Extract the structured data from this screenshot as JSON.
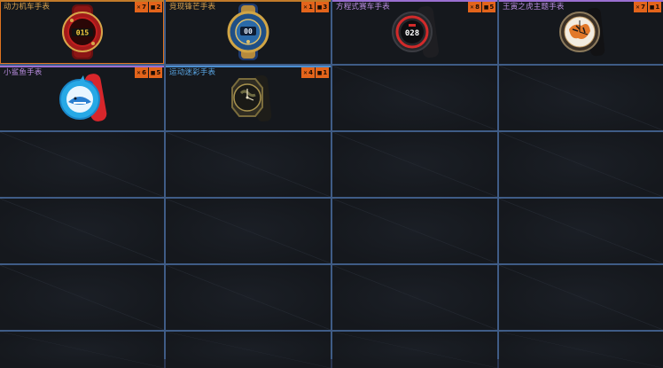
{
  "items": [
    {
      "name": "动力机车手表",
      "name_color": "#d9a24e",
      "line_color": "#c27a2a",
      "badge_a": "7",
      "badge_b": "2",
      "icon": "watch-red-digital-icon"
    },
    {
      "name": "竞现锋芒手表",
      "name_color": "#d9a24e",
      "line_color": "#c27a2a",
      "badge_a": "1",
      "badge_b": "3",
      "icon": "watch-blue-gold-icon"
    },
    {
      "name": "方程式赛车手表",
      "name_color": "#b98de0",
      "line_color": "#9a6fd0",
      "badge_a": "8",
      "badge_b": "5",
      "icon": "watch-racing-black-icon"
    },
    {
      "name": "王寅之虎主题手表",
      "name_color": "#b98de0",
      "line_color": "#9a6fd0",
      "badge_a": "7",
      "badge_b": "1",
      "icon": "watch-tiger-theme-icon"
    },
    {
      "name": "小鲨鱼手表",
      "name_color": "#b98de0",
      "line_color": "#9a6fd0",
      "badge_a": "6",
      "badge_b": "5",
      "icon": "watch-shark-kids-icon"
    },
    {
      "name": "运动迷彩手表",
      "name_color": "#5aa7e6",
      "line_color": "#4c8ed0",
      "badge_a": "4",
      "badge_b": "1",
      "icon": "watch-camo-sport-icon"
    }
  ]
}
